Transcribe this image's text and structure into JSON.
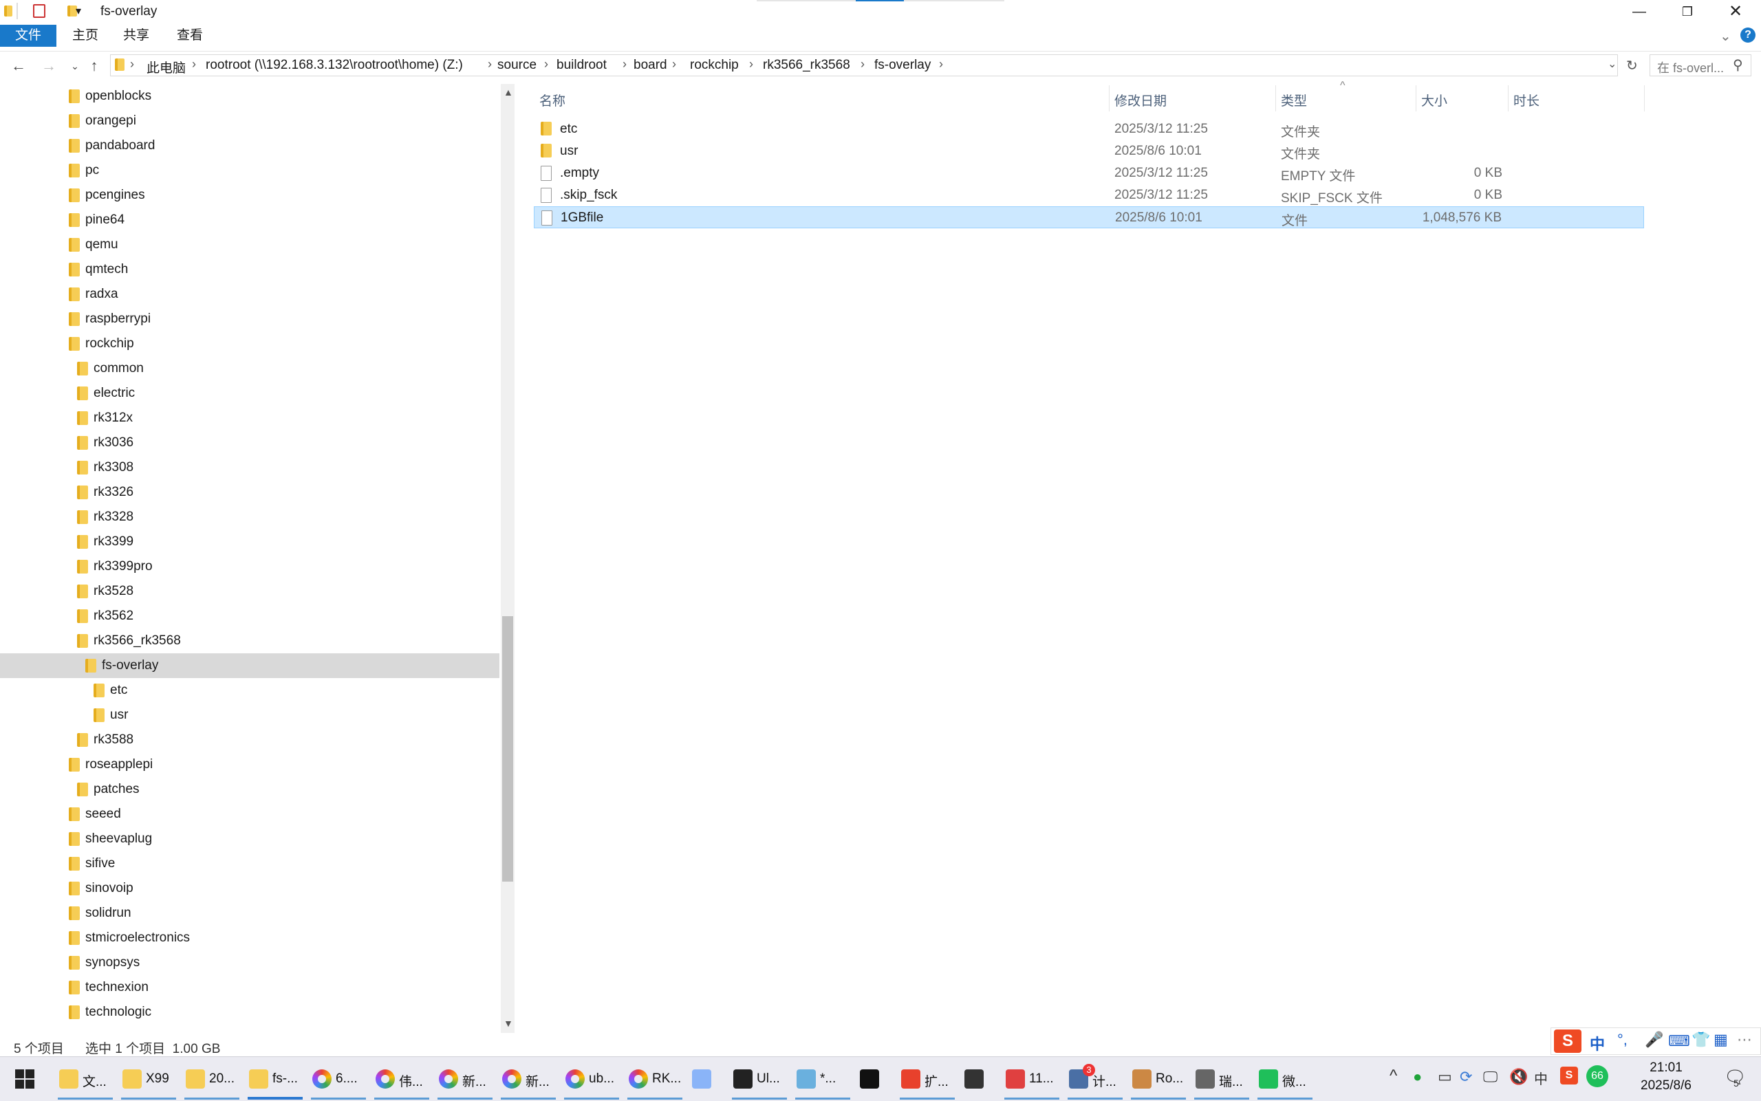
{
  "window": {
    "title": "fs-overlay"
  },
  "ribbon": {
    "tabs": [
      "文件",
      "主页",
      "共享",
      "查看"
    ]
  },
  "address": {
    "crumbs": [
      "此电脑",
      "rootroot (\\\\192.168.3.132\\rootroot\\home) (Z:)",
      "source",
      "buildroot",
      "board",
      "rockchip",
      "rk3566_rk3568",
      "fs-overlay"
    ],
    "search_placeholder": "在 fs-overl..."
  },
  "tree": {
    "items": [
      {
        "label": "openblocks",
        "level": 0
      },
      {
        "label": "orangepi",
        "level": 0
      },
      {
        "label": "pandaboard",
        "level": 0
      },
      {
        "label": "pc",
        "level": 0
      },
      {
        "label": "pcengines",
        "level": 0
      },
      {
        "label": "pine64",
        "level": 0
      },
      {
        "label": "qemu",
        "level": 0
      },
      {
        "label": "qmtech",
        "level": 0
      },
      {
        "label": "radxa",
        "level": 0
      },
      {
        "label": "raspberrypi",
        "level": 0
      },
      {
        "label": "rockchip",
        "level": 0
      },
      {
        "label": "common",
        "level": 1
      },
      {
        "label": "electric",
        "level": 1
      },
      {
        "label": "rk312x",
        "level": 1
      },
      {
        "label": "rk3036",
        "level": 1
      },
      {
        "label": "rk3308",
        "level": 1
      },
      {
        "label": "rk3326",
        "level": 1
      },
      {
        "label": "rk3328",
        "level": 1
      },
      {
        "label": "rk3399",
        "level": 1
      },
      {
        "label": "rk3399pro",
        "level": 1
      },
      {
        "label": "rk3528",
        "level": 1
      },
      {
        "label": "rk3562",
        "level": 1
      },
      {
        "label": "rk3566_rk3568",
        "level": 1
      },
      {
        "label": "fs-overlay",
        "level": 2,
        "selected": true
      },
      {
        "label": "etc",
        "level": 3
      },
      {
        "label": "usr",
        "level": 3
      },
      {
        "label": "rk3588",
        "level": 1
      },
      {
        "label": "roseapplepi",
        "level": 0
      },
      {
        "label": "patches",
        "level": 1
      },
      {
        "label": "seeed",
        "level": 0
      },
      {
        "label": "sheevaplug",
        "level": 0
      },
      {
        "label": "sifive",
        "level": 0
      },
      {
        "label": "sinovoip",
        "level": 0
      },
      {
        "label": "solidrun",
        "level": 0
      },
      {
        "label": "stmicroelectronics",
        "level": 0
      },
      {
        "label": "synopsys",
        "level": 0
      },
      {
        "label": "technexion",
        "level": 0
      },
      {
        "label": "technologic",
        "level": 0
      }
    ]
  },
  "columns": {
    "name": "名称",
    "modified": "修改日期",
    "type": "类型",
    "size": "大小",
    "duration": "时长"
  },
  "files": [
    {
      "name": "etc",
      "modified": "2025/3/12 11:25",
      "type": "文件夹",
      "size": "",
      "kind": "folder"
    },
    {
      "name": "usr",
      "modified": "2025/8/6 10:01",
      "type": "文件夹",
      "size": "",
      "kind": "folder"
    },
    {
      "name": ".empty",
      "modified": "2025/3/12 11:25",
      "type": "EMPTY 文件",
      "size": "0 KB",
      "kind": "file"
    },
    {
      "name": ".skip_fsck",
      "modified": "2025/3/12 11:25",
      "type": "SKIP_FSCK 文件",
      "size": "0 KB",
      "kind": "file"
    },
    {
      "name": "1GBfile",
      "modified": "2025/8/6 10:01",
      "type": "文件",
      "size": "1,048,576 KB",
      "kind": "file",
      "selected": true
    }
  ],
  "status": {
    "count": "5 个项目",
    "selection": "选中 1 个项目  1.00 GB"
  },
  "taskbar": {
    "items": [
      {
        "label": "文...",
        "icon": "explorer-icon"
      },
      {
        "label": "X99",
        "icon": "folder-icon"
      },
      {
        "label": "20...",
        "icon": "folder-icon"
      },
      {
        "label": "fs-...",
        "icon": "folder-icon",
        "active": true
      },
      {
        "label": "6....",
        "icon": "browser-icon"
      },
      {
        "label": "伟...",
        "icon": "browser-icon"
      },
      {
        "label": "新...",
        "icon": "browser-icon"
      },
      {
        "label": "新...",
        "icon": "browser-icon"
      },
      {
        "label": "ub...",
        "icon": "browser-icon"
      },
      {
        "label": "RK...",
        "icon": "browser-icon"
      },
      {
        "label": "",
        "icon": "paint-icon"
      },
      {
        "label": "Ul...",
        "icon": "ultraedit-icon"
      },
      {
        "label": "*...",
        "icon": "notepad-icon"
      },
      {
        "label": "",
        "icon": "terminal-icon"
      },
      {
        "label": "扩...",
        "icon": "wps-icon"
      },
      {
        "label": "",
        "icon": "media-icon"
      },
      {
        "label": "11...",
        "icon": "snail-icon"
      },
      {
        "label": "计...",
        "icon": "computer-icon"
      },
      {
        "label": "Ro...",
        "icon": "app-icon"
      },
      {
        "label": "瑞...",
        "icon": "tool-icon"
      },
      {
        "label": "微...",
        "icon": "wechat-icon"
      }
    ],
    "badge": "3",
    "time": "21:01",
    "date": "2025/8/6",
    "notify_count": "5",
    "ime_label": "中",
    "tray_badge": "66"
  },
  "colors": {
    "accent": "#1979ca",
    "selection": "#cce8ff",
    "folder": "#f6cd55"
  }
}
